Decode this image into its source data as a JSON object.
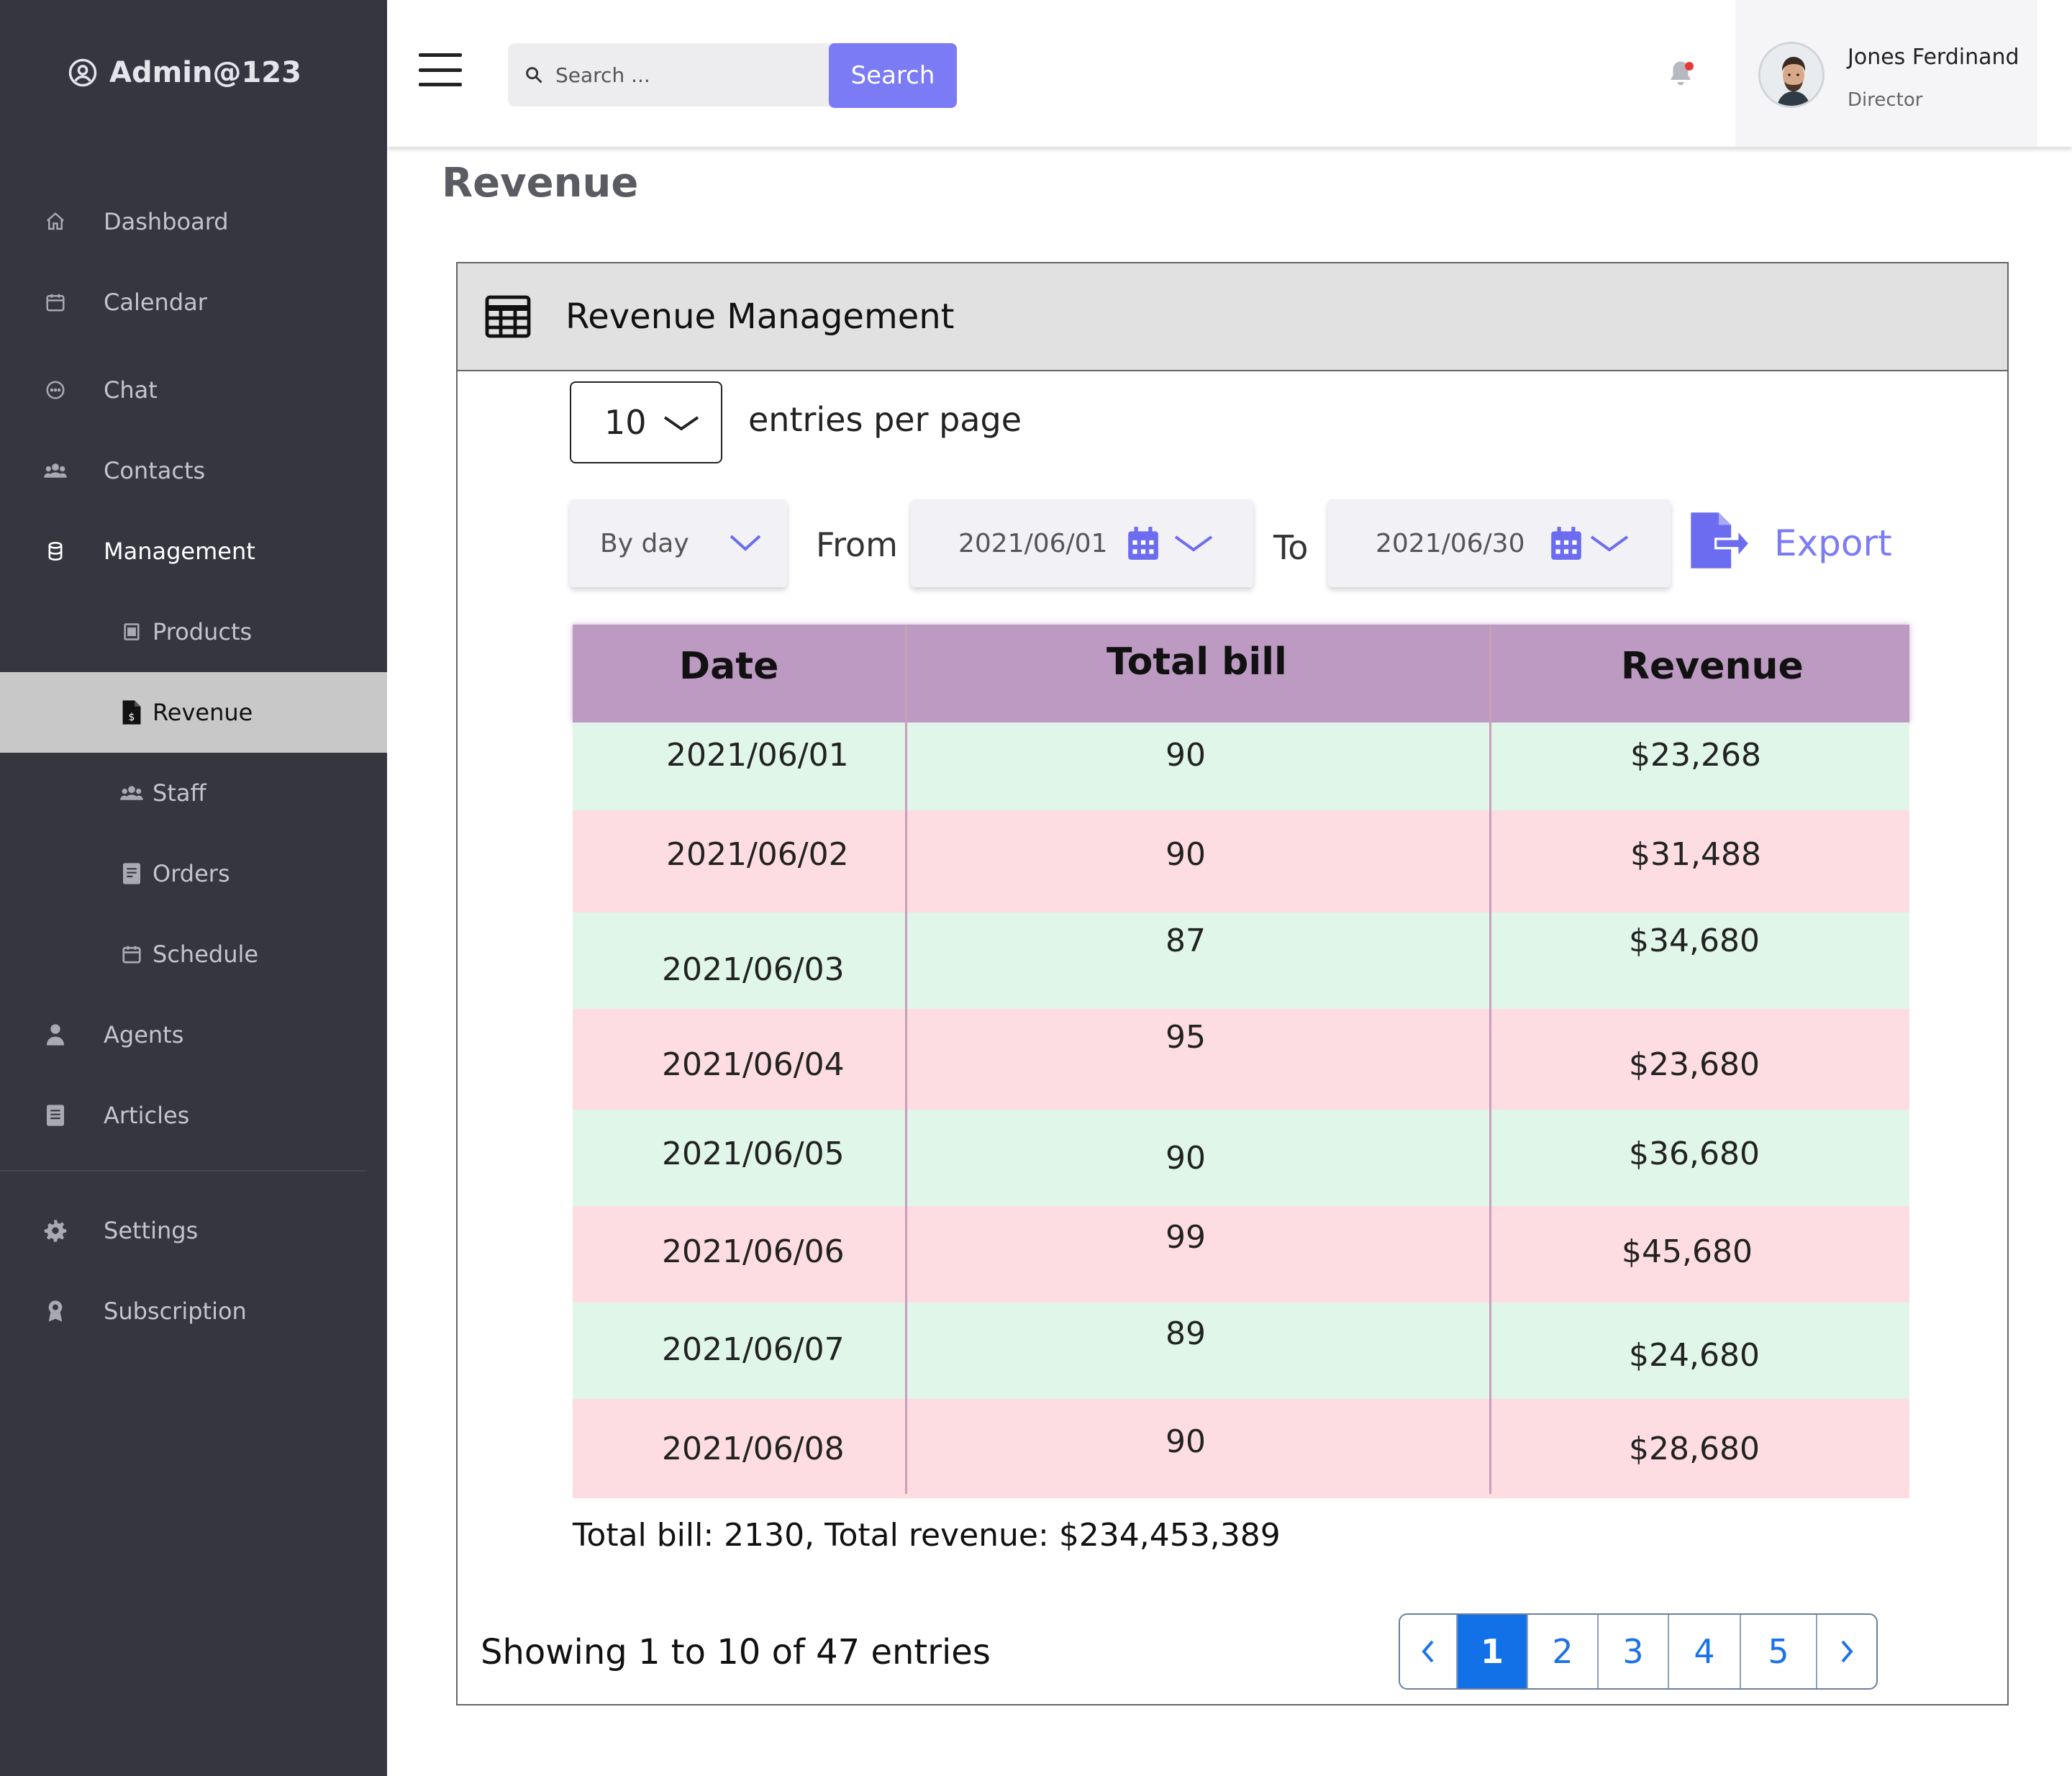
{
  "brand": {
    "title": "Admin@123",
    "icon": "user-circle-icon"
  },
  "sidebar": {
    "items": [
      {
        "label": "Dashboard",
        "icon": "home-icon"
      },
      {
        "label": "Calendar",
        "icon": "calendar-icon"
      },
      {
        "label": "Chat",
        "icon": "chat-icon"
      },
      {
        "label": "Contacts",
        "icon": "contacts-icon"
      },
      {
        "label": "Management",
        "icon": "database-icon"
      },
      {
        "label": "Products",
        "icon": "products-icon"
      },
      {
        "label": "Revenue",
        "icon": "invoice-dollar-icon",
        "active": true
      },
      {
        "label": "Staff",
        "icon": "staff-icon"
      },
      {
        "label": "Orders",
        "icon": "orders-icon"
      },
      {
        "label": "Schedule",
        "icon": "schedule-icon"
      },
      {
        "label": "Agents",
        "icon": "agent-icon"
      },
      {
        "label": "Articles",
        "icon": "articles-icon"
      },
      {
        "label": "Settings",
        "icon": "gear-icon"
      },
      {
        "label": "Subscription",
        "icon": "badge-icon"
      }
    ]
  },
  "header": {
    "search_placeholder": "Search ...",
    "search_button": "Search",
    "user_name": "Jones Ferdinand",
    "user_role": "Director"
  },
  "page": {
    "title": "Revenue"
  },
  "card": {
    "title": "Revenue Management",
    "entries_value": "10",
    "entries_label": "entries per page",
    "group_by": "By day",
    "from_label": "From",
    "from_date": "2021/06/01",
    "to_label": "To",
    "to_date": "2021/06/30",
    "export_label": "Export"
  },
  "table": {
    "headers": [
      "Date",
      "Total bill",
      "Revenue"
    ],
    "rows": [
      [
        "2021/06/01",
        "90",
        "$23,268"
      ],
      [
        "2021/06/02",
        "90",
        "$31,488"
      ],
      [
        "2021/06/03",
        "87",
        "$34,680"
      ],
      [
        "2021/06/04",
        "95",
        "$23,680"
      ],
      [
        "2021/06/05",
        "90",
        "$36,680"
      ],
      [
        "2021/06/06",
        "99",
        "$45,680"
      ],
      [
        "2021/06/07",
        "89",
        "$24,680"
      ],
      [
        "2021/06/08",
        "90",
        "$28,680"
      ]
    ],
    "row_colors": {
      "green": "#dff6e9",
      "pink": "#fddde1",
      "header": "#bc9ac2"
    }
  },
  "summary": {
    "totals": "Total bill: 2130, Total revenue: $234,453,389"
  },
  "footer": {
    "showing": "Showing 1 to 10 of 47 entries",
    "pages": [
      "1",
      "2",
      "3",
      "4",
      "5"
    ],
    "current_page": "1"
  },
  "colors": {
    "accent": "#7b7cf5",
    "sidebar": "#363641",
    "pager_active": "#1371e8"
  }
}
